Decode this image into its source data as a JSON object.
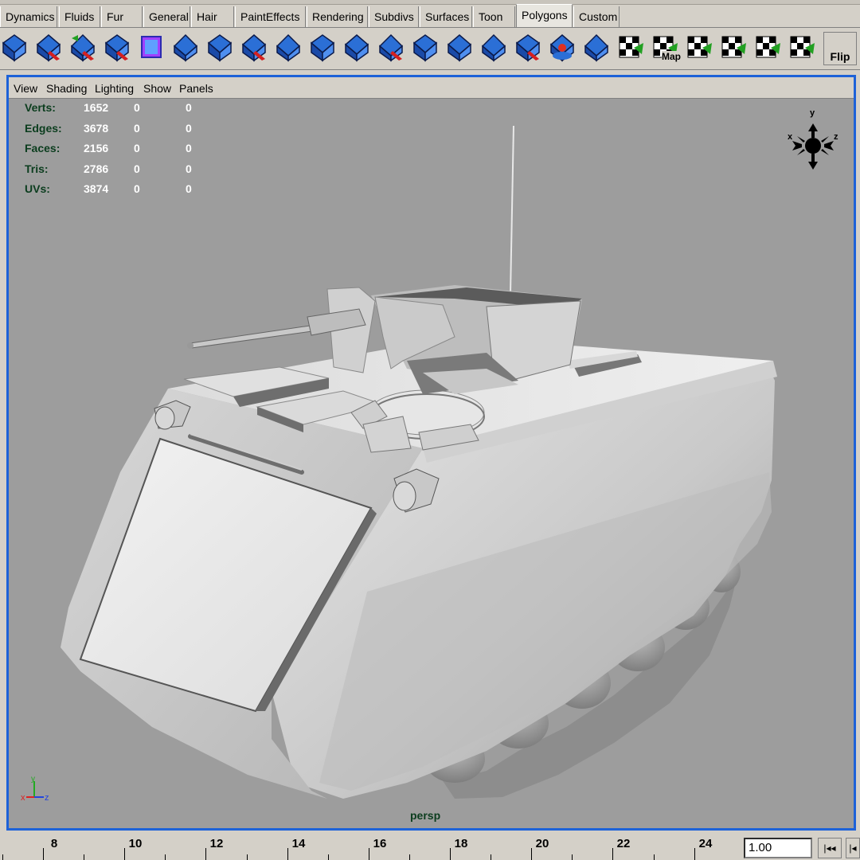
{
  "shelf": {
    "tabs": [
      {
        "label": "Dynamics",
        "active": false
      },
      {
        "label": "Fluids",
        "active": false
      },
      {
        "label": "Fur",
        "active": false
      },
      {
        "label": "General",
        "active": false
      },
      {
        "label": "Hair",
        "active": false
      },
      {
        "label": "PaintEffects",
        "active": false
      },
      {
        "label": "Rendering",
        "active": false
      },
      {
        "label": "Subdivs",
        "active": false
      },
      {
        "label": "Surfaces",
        "active": false
      },
      {
        "label": "Toon",
        "active": false
      },
      {
        "label": "Polygons",
        "active": true
      },
      {
        "label": "Custom",
        "active": false
      }
    ],
    "icons": [
      "sphere-select-icon",
      "combine-icon",
      "separate-icon",
      "extract-icon",
      "cube-bounding-icon",
      "smooth-icon",
      "split-polygon-icon",
      "extrude-face-icon",
      "extrude-edge-icon",
      "bevel-icon",
      "bridge-icon",
      "append-icon",
      "wedge-icon",
      "merge-edges-icon",
      "merge-vertices-icon",
      "collapse-icon",
      "poke-icon",
      "duplicate-face-icon",
      "planar-map-icon",
      "cylindrical-map-icon",
      "spherical-map-icon",
      "automatic-map-icon",
      "texture-editor-icon",
      "uv-snapshot-icon"
    ],
    "map_label": "Map",
    "flip_label": "Flip"
  },
  "viewport": {
    "menu": [
      "View",
      "Shading",
      "Lighting",
      "Show",
      "Panels"
    ],
    "hud": [
      {
        "label": "Verts:",
        "v1": "1652",
        "v2": "0",
        "v3": "0"
      },
      {
        "label": "Edges:",
        "v1": "3678",
        "v2": "0",
        "v3": "0"
      },
      {
        "label": "Faces:",
        "v1": "2156",
        "v2": "0",
        "v3": "0"
      },
      {
        "label": "Tris:",
        "v1": "2786",
        "v2": "0",
        "v3": "0"
      },
      {
        "label": "UVs:",
        "v1": "3874",
        "v2": "0",
        "v3": "0"
      }
    ],
    "view_cube_axes": {
      "x": "x",
      "y": "y",
      "z": "z"
    },
    "axis_triad": {
      "x": "x",
      "y": "y",
      "z": "z"
    },
    "camera_label": "persp",
    "colors": {
      "border": "#1d62d8",
      "background": "#9d9d9d",
      "hud_label": "#0b3d1e"
    }
  },
  "timeline": {
    "labels": [
      "8",
      "10",
      "12",
      "14",
      "16",
      "18",
      "20",
      "22",
      "24"
    ],
    "current_time": "1.00",
    "rewind_label": "|◂◂",
    "step_label": "|◂"
  }
}
